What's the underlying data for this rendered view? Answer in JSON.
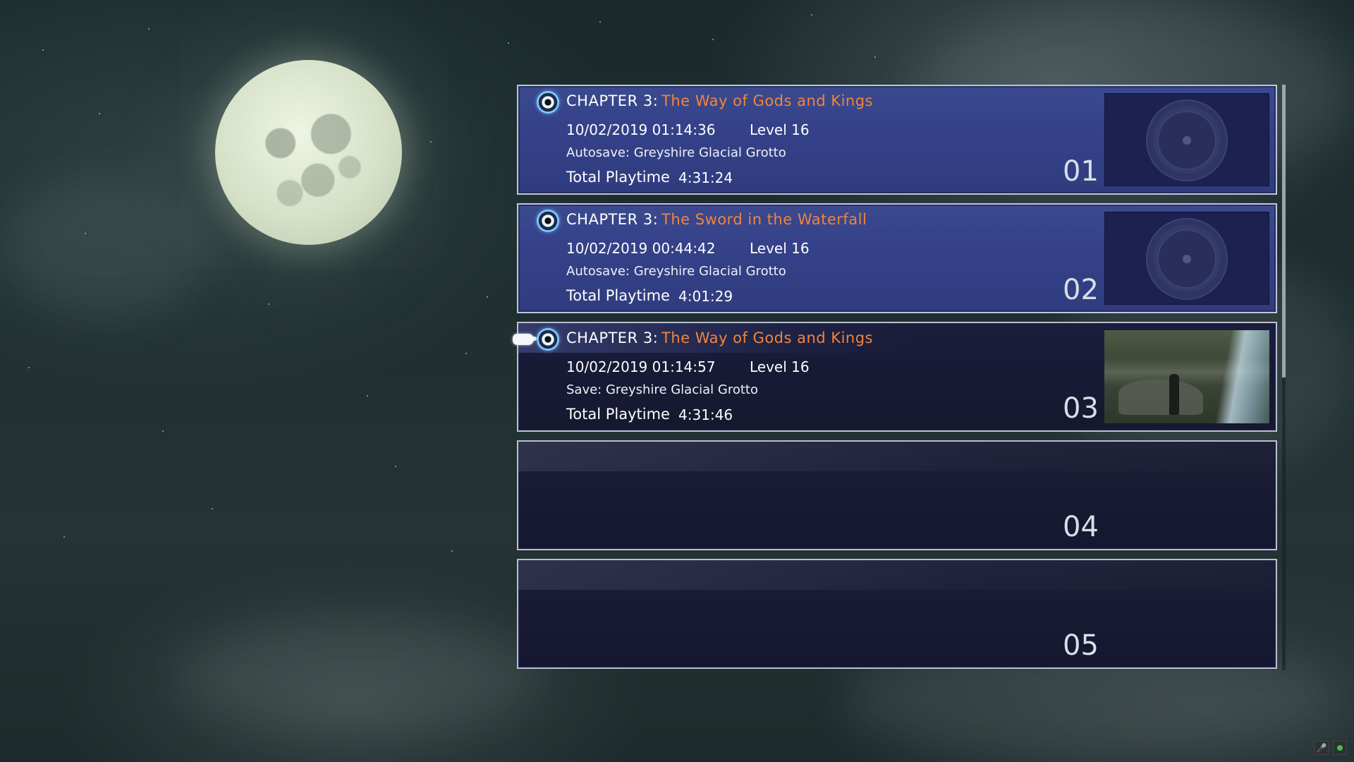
{
  "slots": [
    {
      "chapter_label": "CHAPTER 3:",
      "chapter_title": "The Way of Gods and Kings",
      "datetime": "10/02/2019 01:14:36",
      "level": "Level 16",
      "location": "Autosave: Greyshire Glacial Grotto",
      "playtime_label": "Total Playtime",
      "playtime": "4:31:24",
      "number": "01",
      "thumbnail": "emblem"
    },
    {
      "chapter_label": "CHAPTER 3:",
      "chapter_title": "The Sword in the Waterfall",
      "datetime": "10/02/2019 00:44:42",
      "level": "Level 16",
      "location": "Autosave: Greyshire Glacial Grotto",
      "playtime_label": "Total Playtime",
      "playtime": "4:01:29",
      "number": "02",
      "thumbnail": "emblem"
    },
    {
      "chapter_label": "CHAPTER 3:",
      "chapter_title": "The Way of Gods and Kings",
      "datetime": "10/02/2019 01:14:57",
      "level": "Level 16",
      "location": "Save: Greyshire Glacial Grotto",
      "playtime_label": "Total Playtime",
      "playtime": "4:31:46",
      "number": "03",
      "thumbnail": "scene",
      "selected": true
    },
    {
      "number": "04",
      "empty": true
    },
    {
      "number": "05",
      "empty": true
    }
  ],
  "colors": {
    "chapter_title": "#f0843e",
    "slot_filled": "#35428a",
    "slot_selected": "#15182e"
  },
  "icons": {
    "chapter": "chapter-crystal-icon",
    "pointer": "hand-pointer-icon",
    "tray_mic": "microphone-icon",
    "tray_status": "status-dot-icon"
  }
}
